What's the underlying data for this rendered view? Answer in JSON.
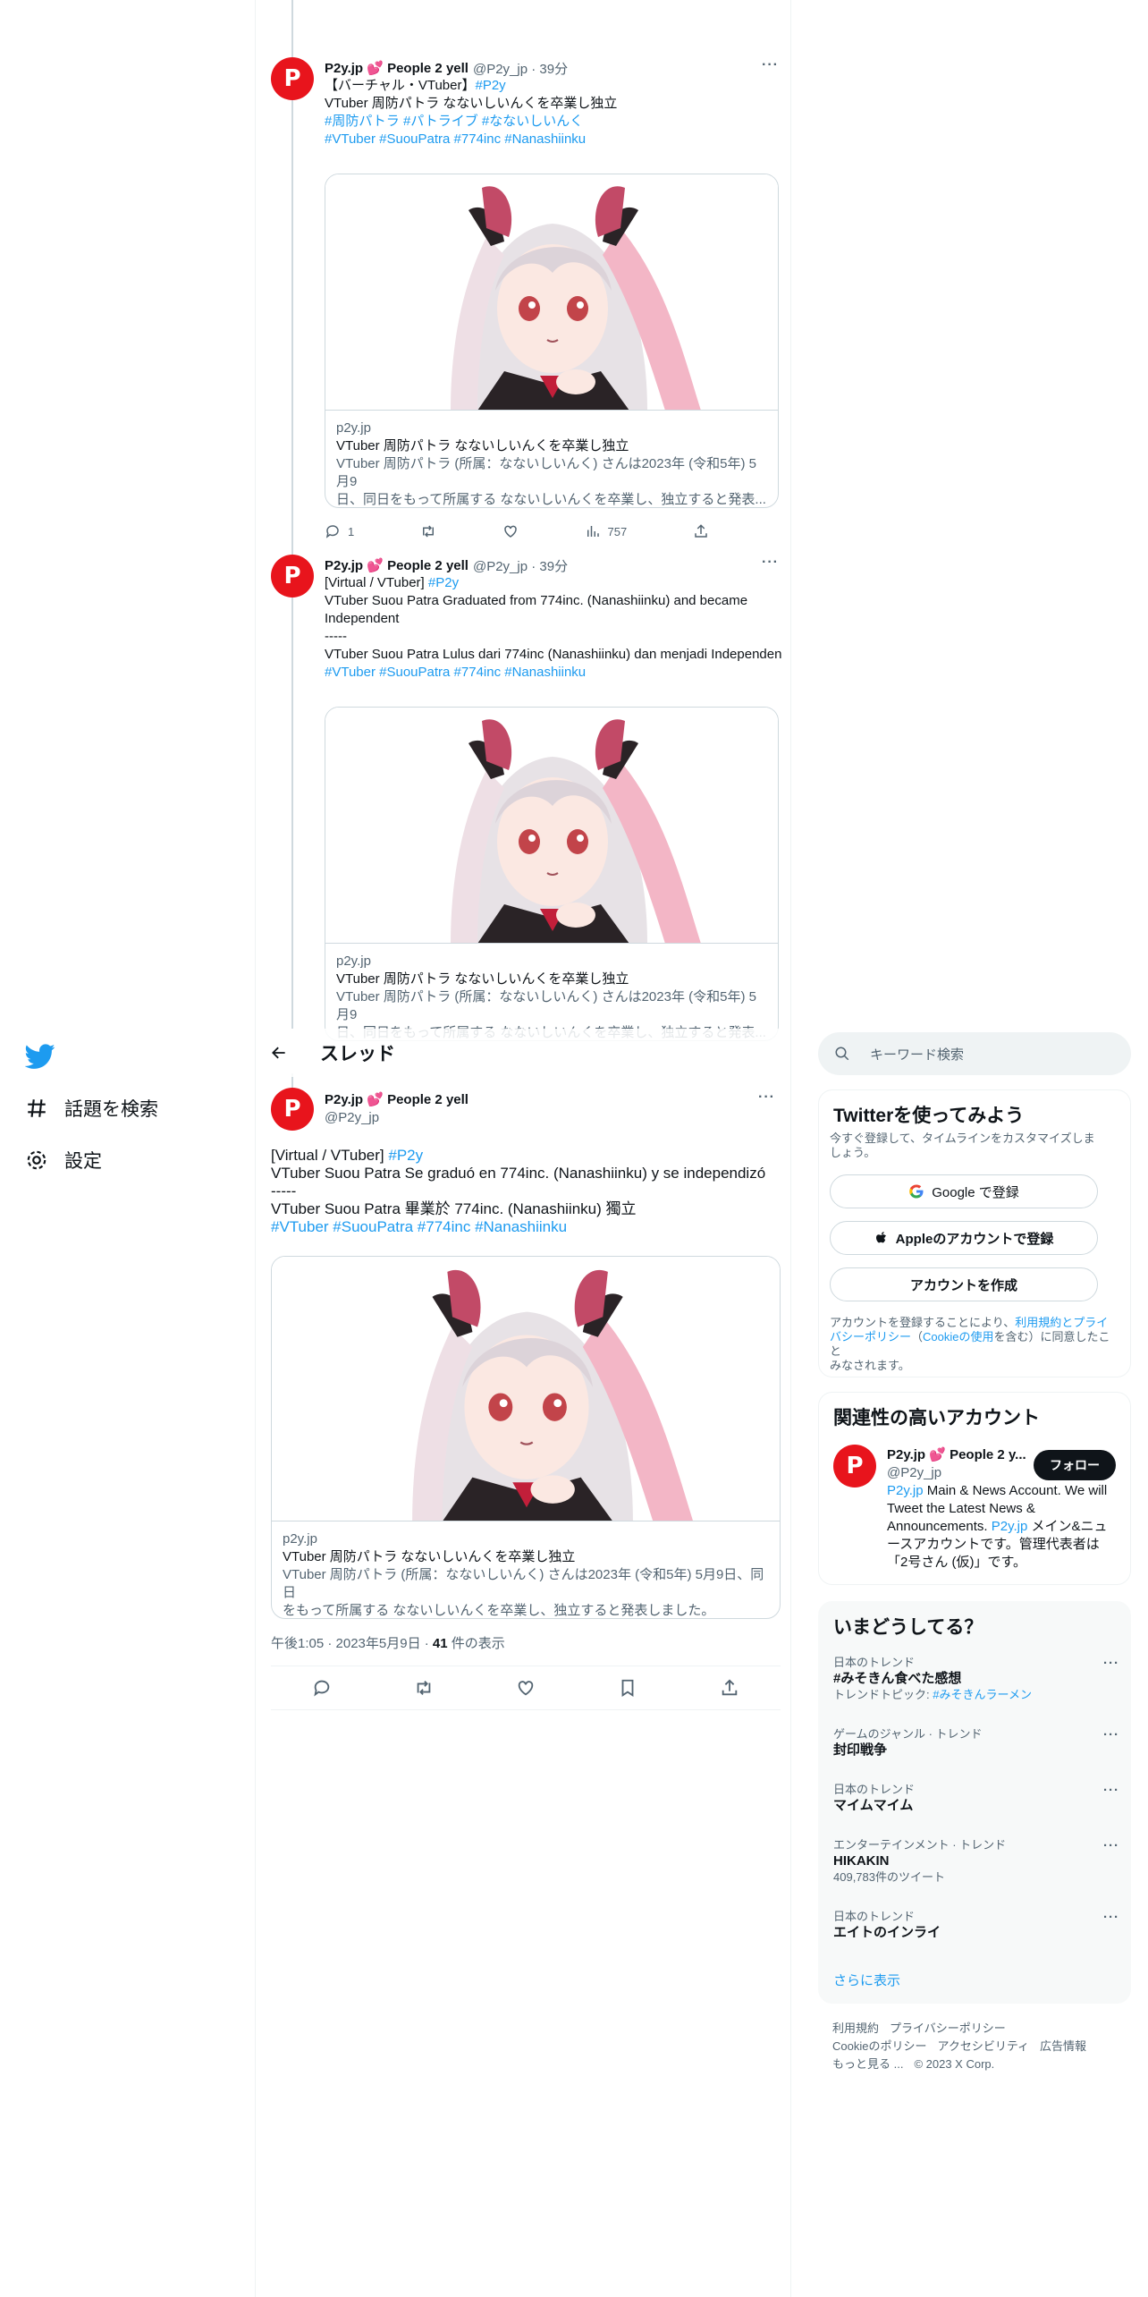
{
  "nav": {
    "explore_label": "話題を検索",
    "settings_label": "設定"
  },
  "thread_header": {
    "title": "スレッド"
  },
  "tweet1": {
    "name": "P2y.jp 💕 People 2 yell",
    "handle": "@P2y_jp · 39分",
    "lines": [
      {
        "text": "【バーチャル・VTuber】",
        "tag": "#P2y"
      },
      {
        "text": "VTuber 周防パトラ なないしいんくを卒業し独立",
        "tag": ""
      },
      {
        "text": "",
        "tag": "#周防パトラ #パトライブ #なないしいんく"
      },
      {
        "text": "",
        "tag": "#VTuber #SuouPatra #774inc #Nanashiinku"
      }
    ],
    "card": {
      "domain": "p2y.jp",
      "title": "VTuber 周防パトラ なないしいんくを卒業し独立",
      "desc1": "VTuber 周防パトラ (所属：なないしいんく) さんは2023年 (令和5年) 5月9",
      "desc2": "日、同日をもって所属する なないしいんくを卒業し、独立すると発表..."
    },
    "replies": "1",
    "views": "757"
  },
  "tweet2": {
    "name": "P2y.jp 💕 People 2 yell",
    "handle": "@P2y_jp · 39分",
    "lines": [
      {
        "text": "[Virtual / VTuber]",
        "tag": "#P2y"
      },
      {
        "text": "VTuber Suou Patra Graduated from 774inc. (Nanashiinku) and became",
        "tag": ""
      },
      {
        "text": "Independent",
        "tag": ""
      },
      {
        "text": "-----",
        "tag": ""
      },
      {
        "text": "VTuber Suou Patra Lulus dari 774inc (Nanashiinku) dan menjadi Independen",
        "tag": ""
      },
      {
        "text": "",
        "tag": "#VTuber #SuouPatra #774inc #Nanashiinku"
      }
    ],
    "card": {
      "domain": "p2y.jp",
      "title": "VTuber 周防パトラ なないしいんくを卒業し独立",
      "desc1": "VTuber 周防パトラ (所属：なないしいんく) さんは2023年 (令和5年) 5月9",
      "desc2": "日、同日をもって所属する なないしいんくを卒業し、独立すると発表..."
    }
  },
  "main_tweet": {
    "name": "P2y.jp 💕 People 2 yell",
    "handle": "@P2y_jp",
    "lines": [
      {
        "text": "[Virtual / VTuber]",
        "tag": "#P2y"
      },
      {
        "text": "VTuber Suou Patra Se graduó en 774inc. (Nanashiinku) y se independizó",
        "tag": ""
      },
      {
        "text": "-----",
        "tag": ""
      },
      {
        "text": "VTuber Suou Patra 畢業於 774inc. (Nanashiinku) 獨立",
        "tag": ""
      },
      {
        "text": "",
        "tag": "#VTuber #SuouPatra #774inc #Nanashiinku"
      }
    ],
    "card": {
      "domain": "p2y.jp",
      "title": "VTuber 周防パトラ なないしいんくを卒業し独立",
      "desc1": "VTuber 周防パトラ (所属：なないしいんく) さんは2023年 (令和5年) 5月9日、同日",
      "desc2": "をもって所属する なないしいんくを卒業し、独立すると発表しました。"
    },
    "time": "午後1:05 · 2023年5月9日 · ",
    "views_count": "41",
    "views_label": " 件の表示"
  },
  "sidebar": {
    "search_placeholder": "キーワード検索",
    "signup": {
      "title": "Twitterを使ってみよう",
      "subtitle1": "今すぐ登録して、タイムラインをカスタマイズしま",
      "subtitle2": "しょう。",
      "google": "Google で登録",
      "apple": "Appleのアカウントで登録",
      "create": "アカウントを作成",
      "terms1a": "アカウントを登録することにより、",
      "terms1b": "利用規約とプライ",
      "terms2a": "バシーポリシー",
      "terms2b": "（",
      "terms2c": "Cookieの使用",
      "terms2d": "を含む）に同意したこと",
      "terms3": "みなされます。"
    },
    "related": {
      "title": "関連性の高いアカウント",
      "name": "P2y.jp 💕 People 2 y...",
      "handle": "@P2y_jp",
      "follow": "フォロー",
      "bio_link": "P2y.jp",
      "bio1": " Main & News Account. We will",
      "bio2": "Tweet the Latest News &",
      "bio3a": "Announcements. ",
      "bio3b": "P2y.jp",
      "bio3c": " メイン&ニュ",
      "bio4": "ースアカウントです。管理代表者は",
      "bio5": "「2号さん (仮)」です。"
    },
    "trends": {
      "title": "いまどうしてる？",
      "items": [
        {
          "cat": "日本のトレンド",
          "name": "#みそきん食べた感想",
          "sub_a": "トレンドトピック: ",
          "sub_b": "#みそきんラーメン"
        },
        {
          "cat": "ゲームのジャンル · トレンド",
          "name": "封印戦争",
          "sub_a": "",
          "sub_b": ""
        },
        {
          "cat": "日本のトレンド",
          "name": "マイムマイム",
          "sub_a": "",
          "sub_b": ""
        },
        {
          "cat": "エンターテインメント · トレンド",
          "name": "HIKAKIN",
          "sub_a": "409,783件のツイート",
          "sub_b": ""
        },
        {
          "cat": "日本のトレンド",
          "name": "エイトのインライ",
          "sub_a": "",
          "sub_b": ""
        }
      ],
      "show_more": "さらに表示"
    },
    "footer": {
      "l1a": "利用規約",
      "l1b": "プライバシーポリシー",
      "l2a": "Cookieのポリシー",
      "l2b": "アクセシビリティ",
      "l2c": "広告情報",
      "l3a": "もっと見る ...",
      "l3b": "© 2023 X Corp."
    }
  }
}
